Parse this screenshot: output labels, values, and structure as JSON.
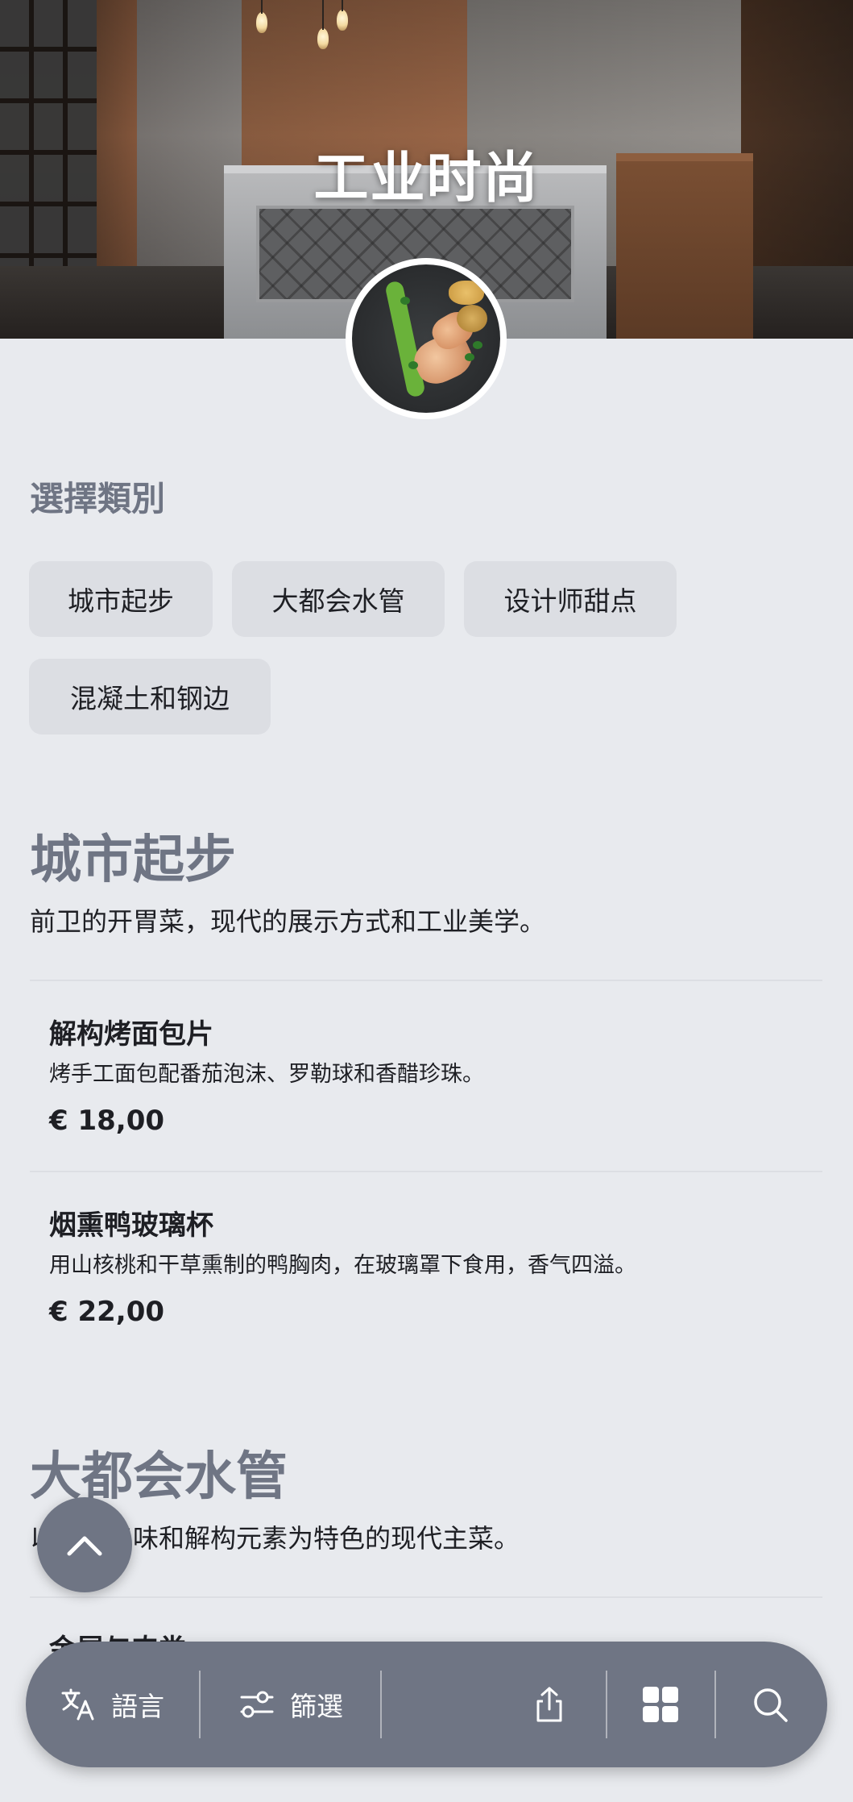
{
  "hero": {
    "title": "工业时尚"
  },
  "categories_header": "選擇類別",
  "category_chips": [
    "城市起步",
    "大都会水管",
    "设计师甜点",
    "混凝土和钢边"
  ],
  "sections": [
    {
      "title": "城市起步",
      "description": "前卫的开胃菜，现代的展示方式和工业美学。",
      "items": [
        {
          "name": "解构烤面包片",
          "description": "烤手工面包配番茄泡沫、罗勒球和香醋珍珠。",
          "price": "€ 18,00"
        },
        {
          "name": "烟熏鸭玻璃杯",
          "description": "用山核桃和干草熏制的鸭胸肉，在玻璃罩下食用，香气四溢。",
          "price": "€ 22,00"
        }
      ]
    },
    {
      "title": "大都会水管",
      "description": "以大胆口味和解构元素为特色的现代主菜。",
      "items": [
        {
          "name": "金属与肉类"
        }
      ]
    }
  ],
  "bottom_bar": {
    "language_label": "語言",
    "filter_label": "篩選"
  },
  "icons": {
    "scroll_top": "chevron-up-icon",
    "language": "translate-icon",
    "filter": "filter-icon",
    "share": "share-icon",
    "grid": "grid-icon",
    "search": "search-icon"
  },
  "colors": {
    "accent": "#6f7584",
    "background": "#e8eaee",
    "chip": "#dcdee3",
    "text": "#1e1f24"
  }
}
